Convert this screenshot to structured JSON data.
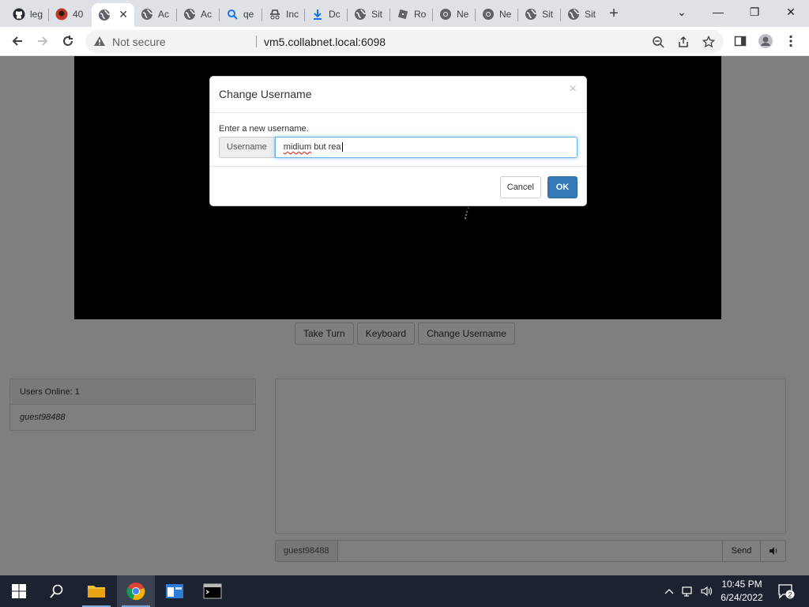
{
  "browser": {
    "tabs": [
      {
        "title": "leg",
        "icon": "github-icon"
      },
      {
        "title": "40",
        "icon": "avatar-icon"
      },
      {
        "title": "",
        "icon": "globe-icon",
        "active": true
      },
      {
        "title": "Ac",
        "icon": "globe-icon"
      },
      {
        "title": "Ac",
        "icon": "globe-icon"
      },
      {
        "title": "qe",
        "icon": "search-icon"
      },
      {
        "title": "Inc",
        "icon": "incognito-icon"
      },
      {
        "title": "Dc",
        "icon": "download-icon"
      },
      {
        "title": "Sit",
        "icon": "globe-icon"
      },
      {
        "title": "Ro",
        "icon": "roblox-icon"
      },
      {
        "title": "Ne",
        "icon": "chrome-icon"
      },
      {
        "title": "Ne",
        "icon": "chrome-icon"
      },
      {
        "title": "Sit",
        "icon": "globe-icon"
      },
      {
        "title": "Sit",
        "icon": "globe-icon"
      }
    ],
    "security_label": "Not secure",
    "url": "vm5.collabnet.local:6098"
  },
  "controls": {
    "take_turn": "Take Turn",
    "keyboard": "Keyboard",
    "change_username": "Change Username"
  },
  "users": {
    "header": "Users Online: 1",
    "list": [
      "guest98488"
    ]
  },
  "chat": {
    "username": "guest98488",
    "message": "",
    "send": "Send"
  },
  "modal": {
    "title": "Change Username",
    "close": "×",
    "prompt": "Enter a new username.",
    "field_label": "Username",
    "value_word1": "midium",
    "value_rest": " but rea",
    "cancel": "Cancel",
    "ok": "OK"
  },
  "taskbar": {
    "time": "10:45 PM",
    "date": "6/24/2022",
    "notifications": "2"
  },
  "colors": {
    "primary": "#337ab7",
    "backdrop": "rgba(0,0,0,0.5)",
    "taskbar": "#1c2230"
  }
}
